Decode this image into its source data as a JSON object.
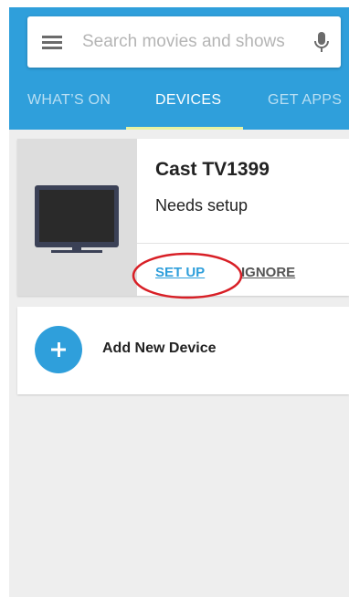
{
  "search": {
    "placeholder": "Search movies and shows",
    "value": ""
  },
  "tabs": [
    {
      "label": "WHAT’S ON",
      "active": false
    },
    {
      "label": "DEVICES",
      "active": true
    },
    {
      "label": "GET APPS",
      "active": false
    }
  ],
  "device": {
    "name": "Cast TV1399",
    "status": "Needs setup",
    "setup_label": "SET UP",
    "ignore_label": "IGNORE",
    "icon": "tv-icon"
  },
  "add_device": {
    "label": "Add New Device",
    "icon": "plus-icon"
  },
  "colors": {
    "accent": "#2f9fdb",
    "tab_indicator": "#e7f2a3",
    "annotation": "#d81f26"
  }
}
